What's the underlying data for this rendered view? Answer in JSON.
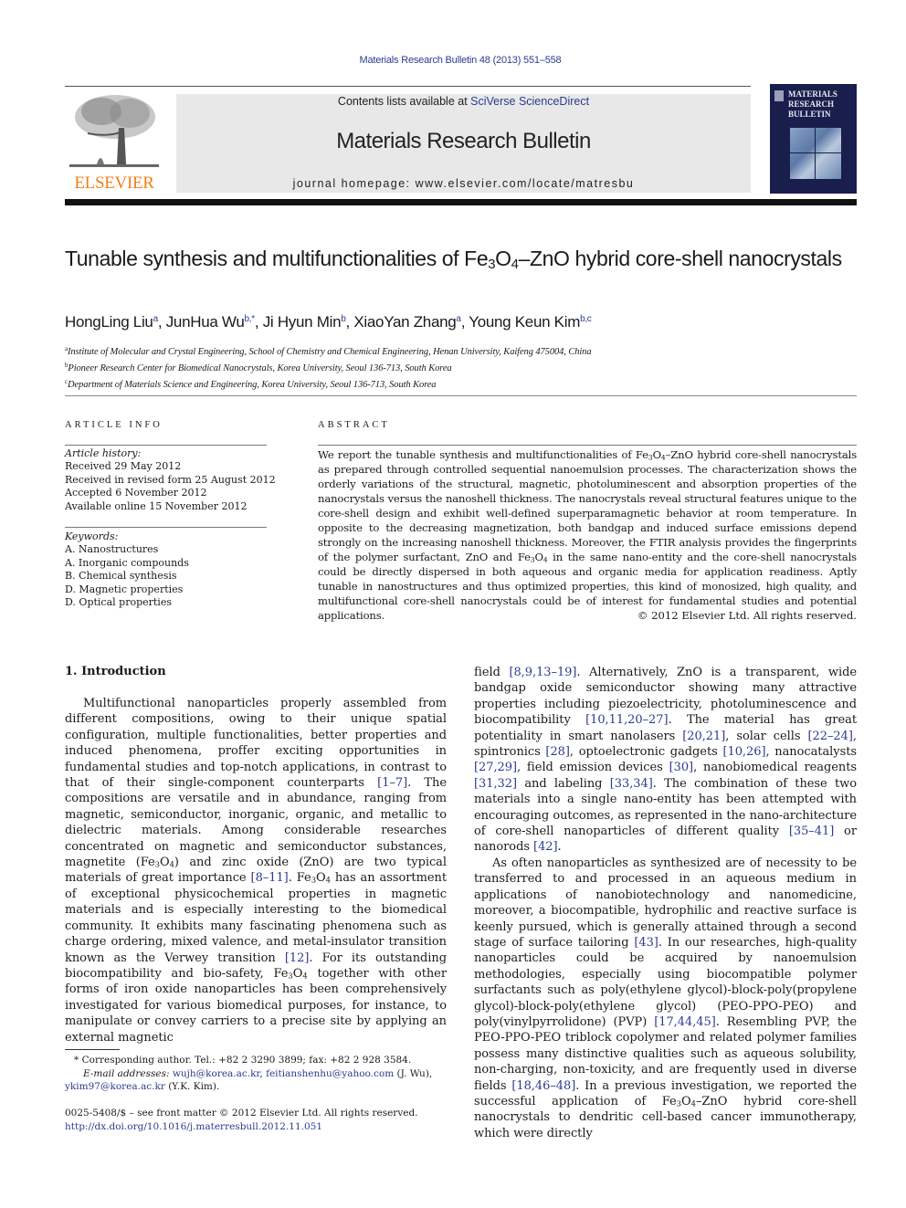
{
  "header": {
    "citation": "Materials Research Bulletin 48 (2013) 551–558",
    "publisher_logo_text": "ELSEVIER",
    "contents_prefix": "Contents lists available at ",
    "contents_link": "SciVerse ScienceDirect",
    "journal_title": "Materials Research Bulletin",
    "homepage": "journal homepage: www.elsevier.com/locate/matresbu",
    "cover_title_lines": [
      "MATERIALS",
      "RESEARCH",
      "BULLETIN"
    ]
  },
  "article": {
    "title_part1": "Tunable synthesis and multifunctionalities of Fe",
    "title_sub1": "3",
    "title_part2": "O",
    "title_sub2": "4",
    "title_part3": "–ZnO hybrid core-shell nanocrystals",
    "authors": [
      {
        "name": "HongLing Liu",
        "aff": "a"
      },
      {
        "name": "JunHua Wu",
        "aff": "b,*"
      },
      {
        "name": "Ji Hyun Min",
        "aff": "b"
      },
      {
        "name": "XiaoYan Zhang",
        "aff": "a"
      },
      {
        "name": "Young Keun Kim",
        "aff": "b,c"
      }
    ],
    "affiliations": [
      {
        "key": "a",
        "text": "Institute of Molecular and Crystal Engineering, School of Chemistry and Chemical Engineering, Henan University, Kaifeng 475004, China"
      },
      {
        "key": "b",
        "text": "Pioneer Research Center for Biomedical Nanocrystals, Korea University, Seoul 136-713, South Korea"
      },
      {
        "key": "c",
        "text": "Department of Materials Science and Engineering, Korea University, Seoul 136-713, South Korea"
      }
    ]
  },
  "article_info": {
    "heading": "ARTICLE INFO",
    "history_label": "Article history:",
    "history": [
      "Received 29 May 2012",
      "Received in revised form 25 August 2012",
      "Accepted 6 November 2012",
      "Available online 15 November 2012"
    ],
    "keywords_label": "Keywords:",
    "keywords": [
      "A. Nanostructures",
      "A. Inorganic compounds",
      "B. Chemical synthesis",
      "D. Magnetic properties",
      "D. Optical properties"
    ]
  },
  "abstract": {
    "heading": "ABSTRACT",
    "text_a": "We report the tunable synthesis and multifunctionalities of Fe",
    "text_b": "–ZnO hybrid core-shell nanocrystals as  prepared through controlled sequential nanoemulsion processes. The characterization shows the orderly variations of the structural, magnetic, photoluminescent and absorption properties of the nanocrystals versus the nanoshell thickness. The nanocrystals reveal structural features unique to the core-shell design and exhibit well-defined superparamagnetic behavior at room temperature. In opposite to the decreasing magnetization, both bandgap and induced surface emissions depend strongly on the increasing nanoshell thickness. Moreover, the FTIR analysis provides the fingerprints of the polymer surfactant, ZnO and Fe",
    "text_c": " in the same nano-entity and the core-shell nanocrystals could be directly dispersed in both aqueous and organic media for application readiness. Aptly tunable in nanostructures and thus optimized properties, this kind of monosized, high quality, and multifunctional core-shell nanocrystals could be of interest for fundamental studies and potential applications.",
    "copyright": "© 2012 Elsevier Ltd. All rights reserved."
  },
  "intro": {
    "heading": "1.  Introduction",
    "left": {
      "p1a": "Multifunctional nanoparticles properly assembled from different compositions, owing to their unique spatial configuration, multiple functionalities, better properties and induced phenomena, proffer exciting opportunities in fundamental studies and top-notch applications, in contrast to that of their single-component counterparts ",
      "ref1": "[1–7]",
      "p1b": ". The compositions are versatile and in abundance, ranging from magnetic, semiconductor, inorganic, organic, and metallic to dielectric materials. Among considerable researches concentrated on magnetic and semiconductor substances, magnetite (Fe",
      "p1c": ") and zinc oxide (ZnO) are two typical materials of great importance ",
      "ref2": "[8–11]",
      "p1d": ". Fe",
      "p1e": " has an assortment of exceptional physicochemical properties in magnetic materials and is especially interesting to the biomedical community. It exhibits many fascinating phenomena such as charge ordering, mixed valence, and metal-insulator transition known as the Verwey transition ",
      "ref3": "[12]",
      "p1f": ". For its outstanding biocompatibility and bio-safety, Fe",
      "p1g": " together with other forms of iron oxide nanoparticles has been comprehensively investigated for various biomedical purposes, for instance, to manipulate or convey carriers to a precise site by applying an external magnetic"
    },
    "right": {
      "a": "field ",
      "r1": "[8,9,13–19]",
      "b": ". Alternatively, ZnO is a transparent, wide bandgap oxide semiconductor showing many attractive properties including piezoelectricity, photoluminescence and biocompatibility ",
      "r2": "[10,11,20–27]",
      "c": ". The material has great potentiality in smart nanolasers ",
      "r3": "[20,21]",
      "d": ", solar cells ",
      "r4": "[22–24]",
      "e": ", spintronics ",
      "r5": "[28]",
      "f": ", optoelectronic gadgets ",
      "r6": "[10,26]",
      "g": ", nanocatalysts ",
      "r7": "[27,29]",
      "h": ", field emission devices ",
      "r8": "[30]",
      "i": ", nanobiomedical reagents ",
      "r9": "[31,32]",
      "j": " and labeling ",
      "r10": "[33,34]",
      "k": ". The combination of these two materials into a single nano-entity has been attempted with encouraging outcomes, as represented in the nano-architecture of core-shell nanoparticles of different quality ",
      "r11": "[35–41]",
      "l": " or nanorods ",
      "r12": "[42]",
      "m": ".",
      "p2a": "As often nanoparticles as synthesized are of necessity to be transferred to and processed in an aqueous medium in applications of nanobiotechnology and nanomedicine, moreover, a biocompatible, hydrophilic and reactive surface is keenly pursued, which is generally attained through a second stage of surface tailoring ",
      "r13": "[43]",
      "p2b": ". In our researches, high-quality nanoparticles could be acquired by nanoemulsion methodologies, especially using biocompatible polymer surfactants such as poly(ethylene glycol)-block-poly(propylene glycol)-block-poly(ethylene glycol) (PEO-PPO-PEO) and poly(vinylpyrrolidone) (PVP) ",
      "r14": "[17,44,45]",
      "p2c": ". Resembling PVP, the PEO-PPO-PEO triblock copolymer and related polymer families possess many distinctive qualities such as aqueous solubility, non-charging, non-toxicity, and are frequently used in diverse fields ",
      "r15": "[18,46–48]",
      "p2d": ". In a previous investigation, we reported the successful application of Fe",
      "p2e": "–ZnO hybrid core-shell nanocrystals to dendritic cell-based cancer immunotherapy, which were directly"
    }
  },
  "chem": {
    "fe": "Fe",
    "s3": "3",
    "o": "O",
    "s4": "4"
  },
  "footnote": {
    "star": "*",
    "corresponding": " Corresponding author. Tel.: +82 2 3290 3899; fax: +82 2 928 3584.",
    "email_label": "E-mail addresses:",
    "email1": "wujh@korea.ac.kr",
    "email2": "feitianshenhu@yahoo.com",
    "email2_suffix": " (J. Wu),",
    "email3": "ykim97@korea.ac.kr",
    "email3_suffix": " (Y.K. Kim).",
    "issn_line": "0025-5408/$ – see front matter © 2012 Elsevier Ltd. All rights reserved.",
    "doi": "http://dx.doi.org/10.1016/j.materresbull.2012.11.051"
  }
}
